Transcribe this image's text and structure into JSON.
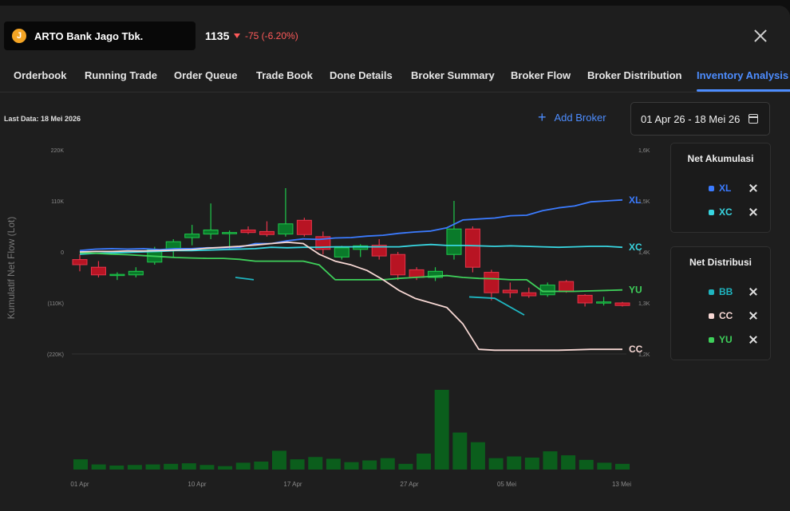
{
  "header": {
    "stock_logo_letter": "J",
    "stock_name": "ARTO Bank Jago Tbk.",
    "price": "1135",
    "change": "-75 (-6.20%)",
    "colors": {
      "down": "#ff5a5a",
      "accent": "#4d8dff",
      "logo": "#f5a524"
    }
  },
  "tabs": [
    {
      "label": "Orderbook",
      "active": false
    },
    {
      "label": "Running Trade",
      "active": false
    },
    {
      "label": "Order Queue",
      "active": false
    },
    {
      "label": "Trade Book",
      "active": false
    },
    {
      "label": "Done Details",
      "active": false
    },
    {
      "label": "Broker Summary",
      "active": false
    },
    {
      "label": "Broker Flow",
      "active": false
    },
    {
      "label": "Broker Distribution",
      "active": false
    },
    {
      "label": "Inventory Analysis",
      "active": true
    }
  ],
  "toolbar": {
    "last_data": "Last Data: 18 Mei 2026",
    "add_broker": "Add Broker",
    "date_range": "01 Apr 26 - 18 Mei 26"
  },
  "net_akumulasi": {
    "title": "Net Akumulasi",
    "items": [
      {
        "label": "XL",
        "color": "#3b7bff"
      },
      {
        "label": "XC",
        "color": "#38d5e0"
      }
    ]
  },
  "net_distribusi": {
    "title": "Net Distribusi",
    "items": [
      {
        "label": "BB",
        "color": "#1fb5c0"
      },
      {
        "label": "CC",
        "color": "#f7d8d4"
      },
      {
        "label": "YU",
        "color": "#3ecf5a"
      }
    ]
  },
  "chart_data": {
    "type": "line",
    "ylabel": "Kumulatif Net Flow (Lot)",
    "y_left_ticks": [
      "220K",
      "110K",
      "0",
      "(110K)",
      "(220K)"
    ],
    "y_left_values": [
      220000,
      110000,
      0,
      -110000,
      -220000
    ],
    "y_right_ticks": [
      "1,6K",
      "1,5K",
      "1,4K",
      "1,3K",
      "1,2K"
    ],
    "x_tick_labels": [
      "01 Apr",
      "10 Apr",
      "17 Apr",
      "27 Apr",
      "05 Mei",
      "13 Mei"
    ],
    "x_tick_index": [
      0,
      6,
      11,
      17,
      22,
      28
    ],
    "candles": [
      {
        "o": 1385,
        "h": 1395,
        "l": 1362,
        "c": 1375
      },
      {
        "o": 1370,
        "h": 1382,
        "l": 1350,
        "c": 1355
      },
      {
        "o": 1355,
        "h": 1360,
        "l": 1345,
        "c": 1356
      },
      {
        "o": 1355,
        "h": 1370,
        "l": 1350,
        "c": 1362
      },
      {
        "o": 1380,
        "h": 1410,
        "l": 1375,
        "c": 1404
      },
      {
        "o": 1405,
        "h": 1425,
        "l": 1390,
        "c": 1420
      },
      {
        "o": 1428,
        "h": 1453,
        "l": 1413,
        "c": 1435
      },
      {
        "o": 1435,
        "h": 1495,
        "l": 1425,
        "c": 1443
      },
      {
        "o": 1438,
        "h": 1442,
        "l": 1405,
        "c": 1438
      },
      {
        "o": 1443,
        "h": 1450,
        "l": 1435,
        "c": 1438
      },
      {
        "o": 1440,
        "h": 1460,
        "l": 1430,
        "c": 1434
      },
      {
        "o": 1435,
        "h": 1525,
        "l": 1430,
        "c": 1455
      },
      {
        "o": 1462,
        "h": 1467,
        "l": 1430,
        "c": 1434
      },
      {
        "o": 1430,
        "h": 1440,
        "l": 1395,
        "c": 1405
      },
      {
        "o": 1390,
        "h": 1412,
        "l": 1385,
        "c": 1408
      },
      {
        "o": 1405,
        "h": 1415,
        "l": 1390,
        "c": 1412
      },
      {
        "o": 1413,
        "h": 1425,
        "l": 1385,
        "c": 1392
      },
      {
        "o": 1395,
        "h": 1400,
        "l": 1345,
        "c": 1355
      },
      {
        "o": 1365,
        "h": 1370,
        "l": 1345,
        "c": 1350
      },
      {
        "o": 1350,
        "h": 1370,
        "l": 1343,
        "c": 1362
      },
      {
        "o": 1395,
        "h": 1500,
        "l": 1385,
        "c": 1445
      },
      {
        "o": 1445,
        "h": 1450,
        "l": 1360,
        "c": 1370
      },
      {
        "o": 1360,
        "h": 1365,
        "l": 1305,
        "c": 1320
      },
      {
        "o": 1325,
        "h": 1340,
        "l": 1310,
        "c": 1320
      },
      {
        "o": 1320,
        "h": 1330,
        "l": 1310,
        "c": 1314
      },
      {
        "o": 1316,
        "h": 1340,
        "l": 1312,
        "c": 1335
      },
      {
        "o": 1342,
        "h": 1345,
        "l": 1320,
        "c": 1322
      },
      {
        "o": 1315,
        "h": 1317,
        "l": 1293,
        "c": 1300
      },
      {
        "o": 1300,
        "h": 1312,
        "l": 1295,
        "c": 1302
      },
      {
        "o": 1300,
        "h": 1302,
        "l": 1293,
        "c": 1295
      }
    ],
    "volume": [
      18,
      9,
      7,
      8,
      9,
      10,
      11,
      8,
      6,
      12,
      14,
      33,
      18,
      22,
      19,
      13,
      16,
      20,
      10,
      28,
      140,
      65,
      48,
      20,
      23,
      21,
      32,
      25,
      17,
      12,
      10
    ],
    "series": [
      {
        "name": "XL",
        "color": "#3b7bff",
        "values": [
          3,
          6,
          7,
          6,
          7,
          5,
          7,
          7,
          9,
          9,
          10,
          18,
          18,
          24,
          28,
          27,
          30,
          31,
          34,
          36,
          40,
          43,
          45,
          52,
          69,
          71,
          73,
          78,
          79,
          89,
          95,
          99,
          108,
          110,
          112
        ]
      },
      {
        "name": "XC",
        "color": "#38d5e0",
        "values": [
          -5,
          -3,
          -2,
          -1,
          0,
          1,
          3,
          3,
          4,
          5,
          6,
          7,
          10,
          9,
          10,
          10,
          11,
          11,
          11,
          11,
          11,
          14,
          16,
          14,
          14,
          13,
          12,
          13,
          12,
          11,
          10,
          11,
          12,
          12,
          10
        ]
      },
      {
        "name": "YU",
        "color": "#3ecf5a",
        "values": [
          -2,
          -3,
          -5,
          -6,
          -8,
          -10,
          -12,
          -13,
          -14,
          -14,
          -16,
          -20,
          -20,
          -20,
          -20,
          -28,
          -60,
          -60,
          -60,
          -60,
          -57,
          -55,
          -53,
          -51,
          -55,
          -57,
          -58,
          -60,
          -60,
          -85,
          -85,
          -85,
          -84,
          -83,
          -82
        ]
      },
      {
        "name": "CC",
        "color": "#f7d8d4",
        "values": [
          0,
          1,
          1,
          2,
          2,
          3,
          4,
          5,
          8,
          10,
          12,
          15,
          18,
          21,
          18,
          -5,
          -20,
          -28,
          -40,
          -60,
          -83,
          -100,
          -110,
          -120,
          -155,
          -210,
          -212,
          -212,
          -212,
          -212,
          -212,
          -211,
          -210,
          -210,
          -210
        ]
      }
    ],
    "bb_segments": [
      [
        [
          -55,
          -55
        ],
        [
          -57,
          -57
        ]
      ],
      [
        [
          -60,
          -68
        ]
      ]
    ]
  }
}
